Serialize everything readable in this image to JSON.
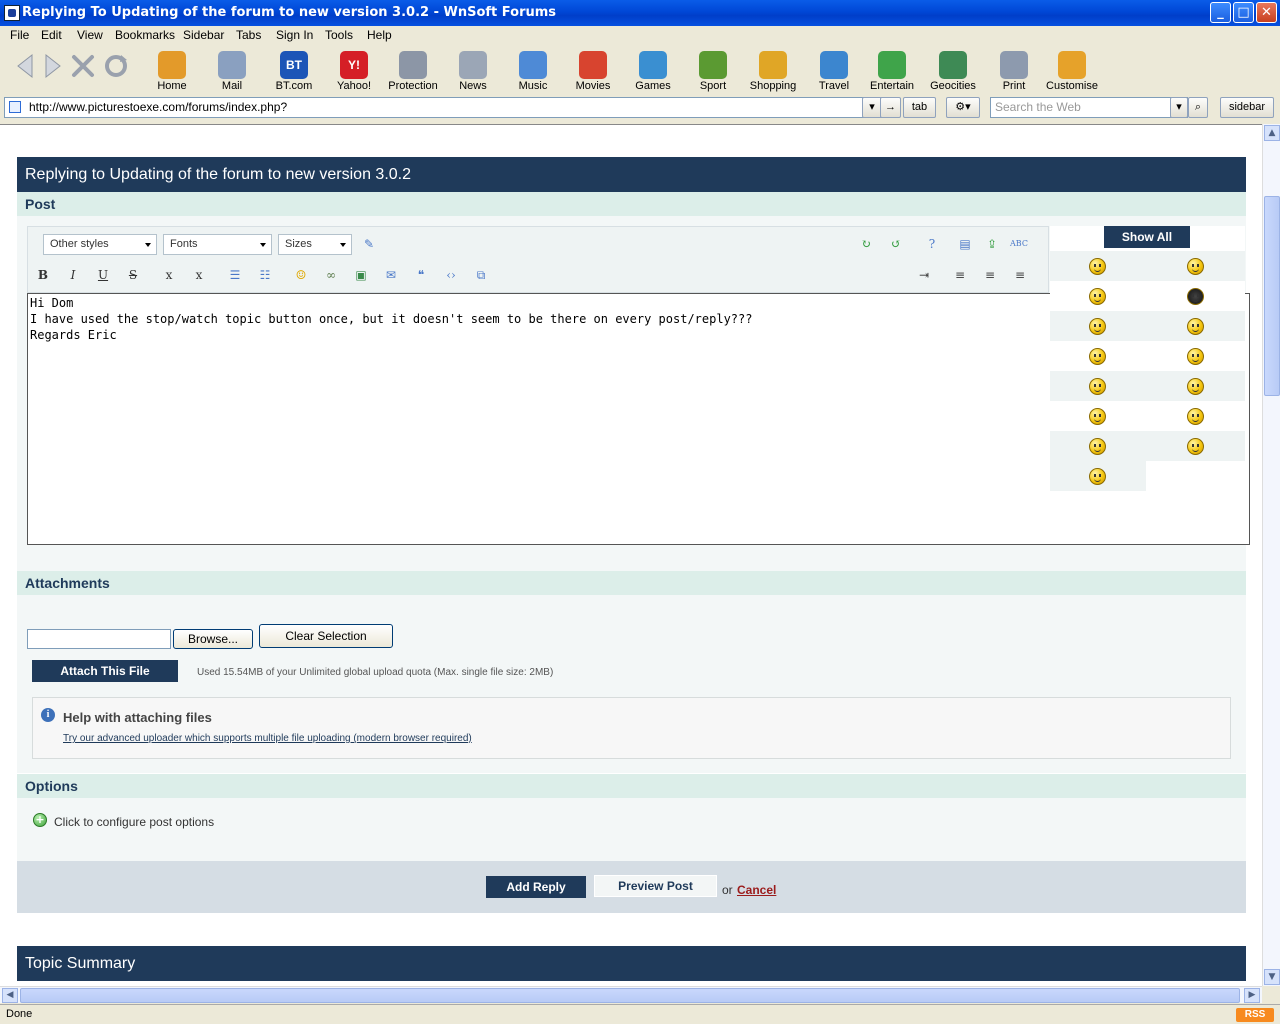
{
  "window": {
    "title": "Replying To Updating of the forum to new version 3.0.2 - WnSoft Forums",
    "minimize": "_",
    "maximize": "□",
    "close": "✕"
  },
  "menu": [
    "File",
    "Edit",
    "View",
    "Bookmarks",
    "Sidebar",
    "Tabs",
    "Sign In",
    "Tools",
    "Help"
  ],
  "toolbar": {
    "buttons": [
      {
        "label": "Home",
        "icon": "home-icon",
        "color": "#e39a2a"
      },
      {
        "label": "Mail",
        "icon": "mail-icon",
        "color": "#8aa0c0"
      },
      {
        "label": "BT.com",
        "icon": "bt-icon",
        "color": "#1c55b7",
        "text": "BT"
      },
      {
        "label": "Yahoo!",
        "icon": "yahoo-icon",
        "color": "#d51f26",
        "text": "Y!"
      },
      {
        "label": "Protection",
        "icon": "shield-icon",
        "color": "#8c96a6"
      },
      {
        "label": "News",
        "icon": "news-icon",
        "color": "#9ba6b6"
      },
      {
        "label": "Music",
        "icon": "music-icon",
        "color": "#4e8ad6"
      },
      {
        "label": "Movies",
        "icon": "popcorn-icon",
        "color": "#d8442f"
      },
      {
        "label": "Games",
        "icon": "dice-icon",
        "color": "#3a8fd1"
      },
      {
        "label": "Sport",
        "icon": "ball-icon",
        "color": "#5b9a32"
      },
      {
        "label": "Shopping",
        "icon": "bag-icon",
        "color": "#e0a626"
      },
      {
        "label": "Travel",
        "icon": "suitcase-icon",
        "color": "#3c86cf"
      },
      {
        "label": "Entertain",
        "icon": "star-icon",
        "color": "#3fa44a"
      },
      {
        "label": "Geocities",
        "icon": "globe-icon",
        "color": "#3e8a55"
      },
      {
        "label": "Print",
        "icon": "printer-icon",
        "color": "#8d9aae"
      },
      {
        "label": "Customise",
        "icon": "pencil-icon",
        "color": "#e6a22a"
      }
    ]
  },
  "address": {
    "url": "http://www.picturestoexe.com/forums/index.php?",
    "go": "→",
    "tab": "tab",
    "search_placeholder": "Search the Web",
    "sidebar": "sidebar"
  },
  "page": {
    "header": "Replying to Updating of the forum to new version 3.0.2",
    "post_section": "Post",
    "editor": {
      "style_select": "Other styles",
      "font_select": "Fonts",
      "size_select": "Sizes",
      "bold": "B",
      "italic": "I",
      "underline": "U",
      "strike": "S",
      "subscript": "x",
      "superscript": "x"
    },
    "message_lines": [
      "Hi Dom",
      "I have used the stop/watch topic button once, but it doesn't seem to be there on every post/reply???",
      "Regards Eric"
    ],
    "show_all": "Show All",
    "attachments": {
      "section": "Attachments",
      "browse": "Browse...",
      "clear": "Clear Selection",
      "attach": "Attach This File",
      "quota": "Used 15.54MB of your Unlimited global upload quota (Max. single file size: 2MB)",
      "help_title": "Help with attaching files",
      "help_link": "Try our advanced uploader which supports multiple file uploading (modern browser required)"
    },
    "options": {
      "section": "Options",
      "configure": "Click to configure post options"
    },
    "actions": {
      "add_reply": "Add Reply",
      "preview": "Preview Post",
      "or": "or",
      "cancel": "Cancel"
    },
    "topic_summary": "Topic Summary"
  },
  "status": {
    "text": "Done",
    "rss": "RSS"
  },
  "colors": {
    "header_bg": "#1f3a5a",
    "subheader_bg": "#dceee9",
    "cancel_link": "#9b1b1b"
  }
}
